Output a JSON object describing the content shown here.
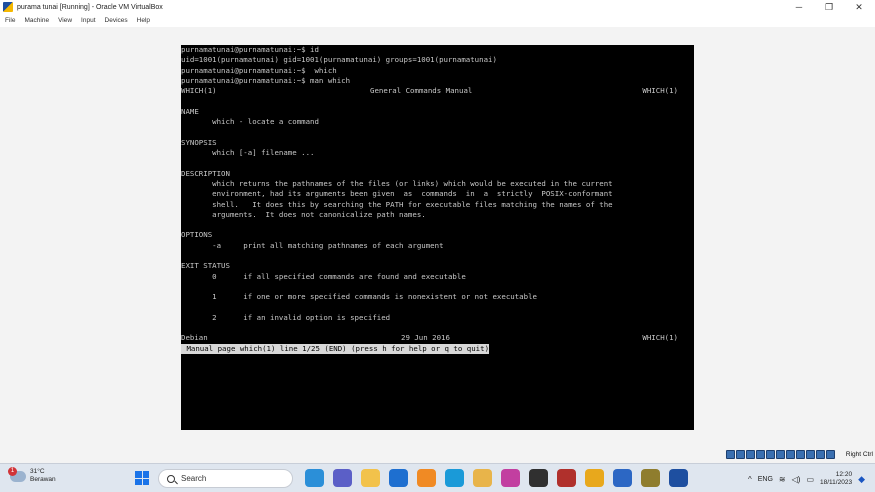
{
  "window": {
    "title": "purama tunai [Running] - Oracle VM VirtualBox",
    "controls": {
      "minimize": "─",
      "maximize": "❐",
      "close": "✕"
    }
  },
  "menu": [
    "File",
    "Machine",
    "View",
    "Input",
    "Devices",
    "Help"
  ],
  "terminal": {
    "lines": [
      "purnamatunai@purnamatunai:~$ id",
      "uid=1001(purnamatunai) gid=1001(purnamatunai) groups=1001(purnamatunai)",
      "purnamatunai@purnamatunai:~$  which",
      "purnamatunai@purnamatunai:~$ man which"
    ],
    "man_header": {
      "left": "WHICH(1)",
      "center": "General Commands Manual",
      "right": "WHICH(1)"
    },
    "body": [
      "",
      "NAME",
      "       which - locate a command",
      "",
      "SYNOPSIS",
      "       which [-a] filename ...",
      "",
      "DESCRIPTION",
      "       which returns the pathnames of the files (or links) which would be executed in the current",
      "       environment, had its arguments been given  as  commands  in  a  strictly  POSIX-conformant",
      "       shell.   It does this by searching the PATH for executable files matching the names of the",
      "       arguments.  It does not canonicalize path names.",
      "",
      "OPTIONS",
      "       -a     print all matching pathnames of each argument",
      "",
      "EXIT STATUS",
      "       0      if all specified commands are found and executable",
      "",
      "       1      if one or more specified commands is nonexistent or not executable",
      "",
      "       2      if an invalid option is specified",
      ""
    ],
    "man_footer": {
      "left": "Debian",
      "center": "29 Jun 2016",
      "right": "WHICH(1)"
    },
    "status": " Manual page which(1) line 1/25 (END) (press h for help or q to quit)"
  },
  "vbox_status": {
    "host_key": "Right Ctrl"
  },
  "taskbar": {
    "weather": {
      "temp": "31°C",
      "desc": "Berawan",
      "badge": "1"
    },
    "search_label": "Search",
    "tray": {
      "lang": "ENG",
      "time": "12:20",
      "date": "18/11/2023"
    }
  }
}
